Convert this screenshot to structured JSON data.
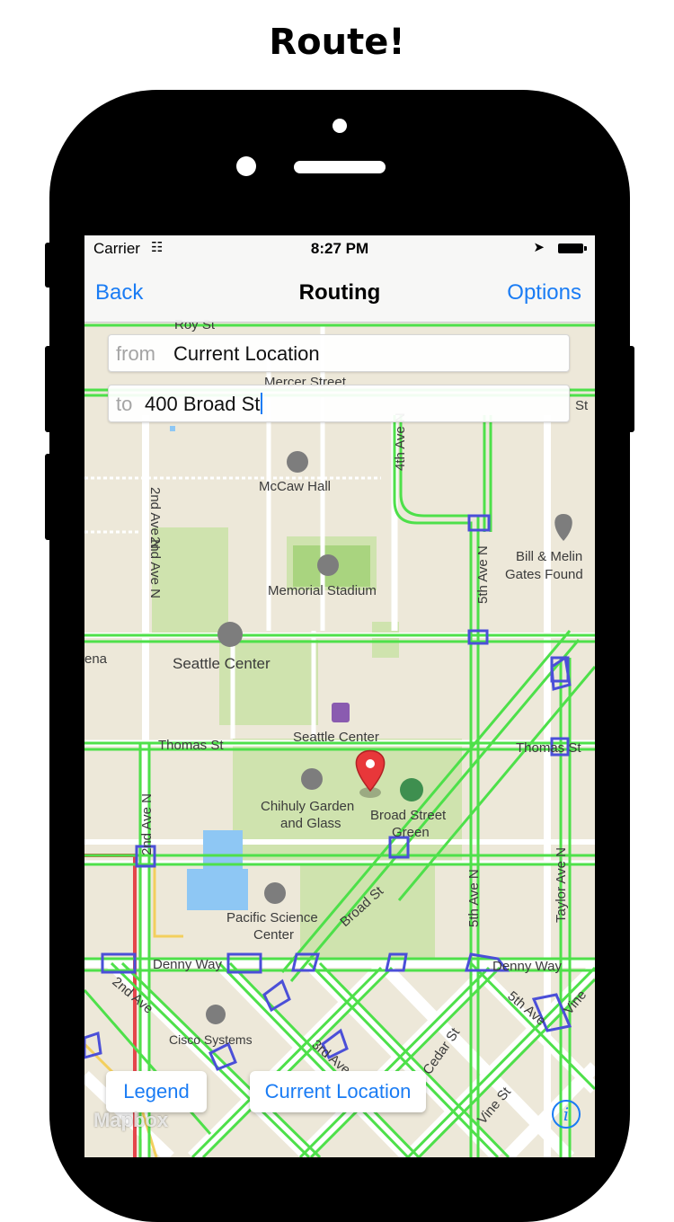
{
  "headline": "Route!",
  "status_bar": {
    "carrier": "Carrier",
    "time": "8:27 PM"
  },
  "nav": {
    "back": "Back",
    "title": "Routing",
    "options": "Options"
  },
  "route": {
    "from_label": "from",
    "from_value": "Current Location",
    "to_label": "to",
    "to_value": "400 Broad St"
  },
  "map_labels": {
    "roy_st": "Roy St",
    "mercer_st": "Mercer Street",
    "mercer_st_right": "St",
    "ave_4th": "4th Ave N",
    "ave_2nd_a": "2nd Ave N",
    "ave_2nd_b": "2nd Ave N",
    "mccaw_hall": "McCaw Hall",
    "memorial_stadium": "Memorial Stadium",
    "gates_1": "Bill & Melin",
    "gates_2": "Gates Found",
    "ave_5th_a": "5th Ave N",
    "ena": "ena",
    "seattle_center_park": "Seattle Center",
    "seattle_center_station": "Seattle Center",
    "thomas_st_left": "Thomas St",
    "thomas_st_right": "Thomas St",
    "chihuly_1": "Chihuly Garden",
    "chihuly_2": "and Glass",
    "broad_green_1": "Broad Street",
    "broad_green_2": "Green",
    "ave_2nd_c": "2nd Ave N",
    "broad_st": "Broad St",
    "ave_5th_b": "5th Ave N",
    "taylor_ave": "Taylor Ave N",
    "pacific_1": "Pacific Science",
    "pacific_2": "Center",
    "denny_left": "Denny Way",
    "denny_right": "Denny Way",
    "ave_2nd_d": "2nd Ave",
    "ave_5th_c": "5th Ave",
    "vine_right": "Vine",
    "cisco": "Cisco Systems",
    "ave_3rd": "3rd Ave",
    "cedar_st": "Cedar St",
    "vine_st": "Vine St"
  },
  "buttons": {
    "legend": "Legend",
    "current_location": "Current Location",
    "info": "i"
  },
  "attribution": "Mapbox",
  "colors": {
    "accent": "#1a7cf4",
    "bike_route": "#4ee04a",
    "bike_lane_outline": "#4b4fd8",
    "park": "#cfe3ae",
    "water": "#8ec7f4",
    "map_background": "#ede8d9",
    "pin": "#e8373a"
  }
}
